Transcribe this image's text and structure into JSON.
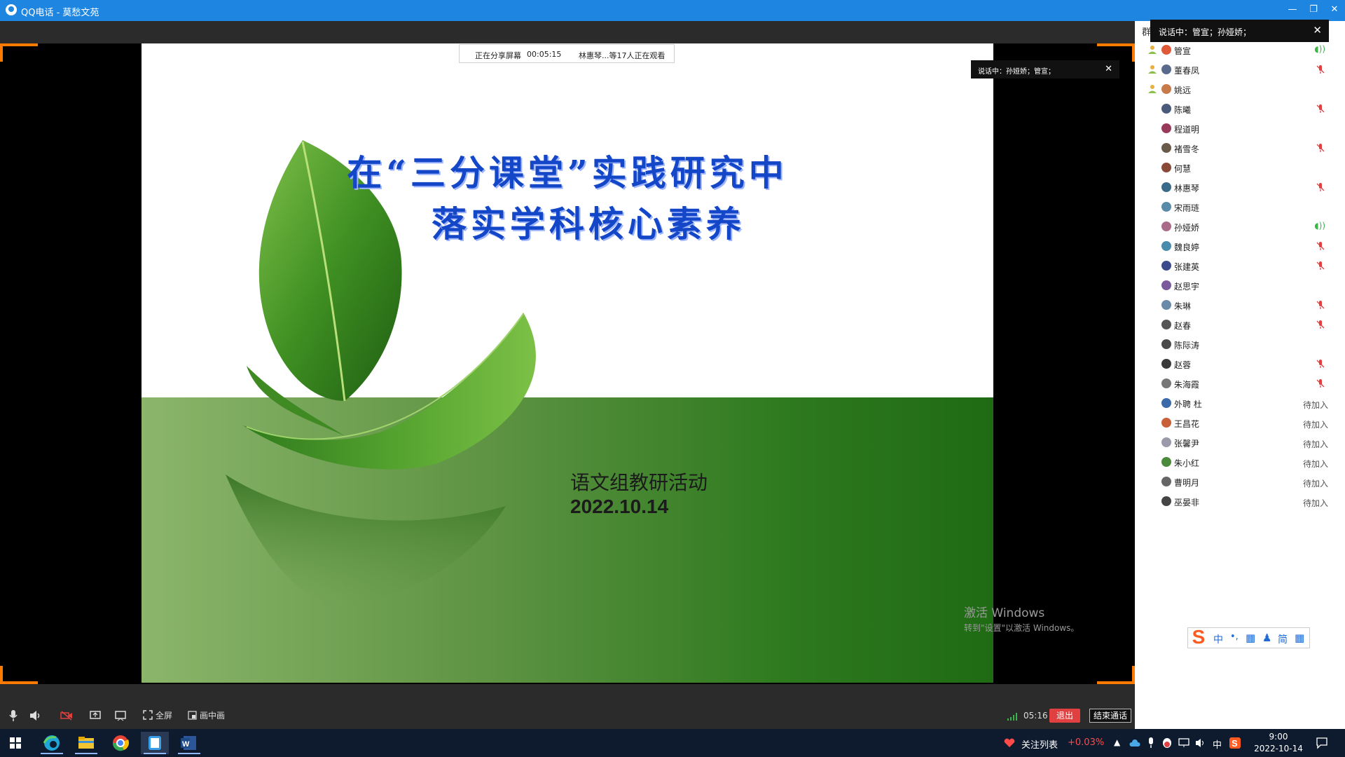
{
  "window": {
    "title": "QQ电话 - 莫愁文苑",
    "minimize": "—",
    "restore": "❐",
    "close": "✕"
  },
  "share_bar": {
    "sharing": "正在分享屏幕",
    "time": "00:05:15",
    "viewers": "林惠琴...等17人正在观看"
  },
  "speaking_popup": {
    "text": "说话中：孙娅娇；管宣；",
    "close": "✕"
  },
  "slide": {
    "title_line1": "在“三分课堂”实践研究中",
    "title_line2": "落实学科核心素养",
    "subtitle": "语文组教研活动",
    "date": "2022.10.14"
  },
  "watermark": {
    "line1": "激活 Windows",
    "line2": "转到\"设置\"以激活 Windows。"
  },
  "sidebar": {
    "header_char": "群",
    "speaking_tip": "说话中：管宣；孙娅娇；",
    "speaking_close": "✕",
    "members": [
      {
        "name": "管宣",
        "crown": true,
        "state": "speaking",
        "color": "#e05a3a"
      },
      {
        "name": "董春凤",
        "crown": true,
        "state": "muted",
        "color": "#5a6a8a"
      },
      {
        "name": "姚远",
        "crown": true,
        "state": "none",
        "color": "#c87a4a"
      },
      {
        "name": "陈曦",
        "crown": false,
        "state": "muted",
        "color": "#4a5a7a"
      },
      {
        "name": "程道明",
        "crown": false,
        "state": "none",
        "color": "#9a3a5a"
      },
      {
        "name": "褚雪冬",
        "crown": false,
        "state": "muted",
        "color": "#6a5a4a"
      },
      {
        "name": "何慧",
        "crown": false,
        "state": "none",
        "color": "#8a4a3a"
      },
      {
        "name": "林惠琴",
        "crown": false,
        "state": "muted",
        "color": "#3a6a8a"
      },
      {
        "name": "宋雨琏",
        "crown": false,
        "state": "none",
        "color": "#5a8aaa"
      },
      {
        "name": "孙娅娇",
        "crown": false,
        "state": "speaking",
        "color": "#aa6a8a"
      },
      {
        "name": "魏良婷",
        "crown": false,
        "state": "muted",
        "color": "#4a8aaa"
      },
      {
        "name": "张建英",
        "crown": false,
        "state": "muted",
        "color": "#3a4a8a"
      },
      {
        "name": "赵思宇",
        "crown": false,
        "state": "none",
        "color": "#7a5a9a"
      },
      {
        "name": "朱琳",
        "crown": false,
        "state": "muted",
        "color": "#6a8aaa"
      },
      {
        "name": "赵春",
        "crown": false,
        "state": "muted",
        "color": "#555555"
      },
      {
        "name": "陈际涛",
        "crown": false,
        "state": "none",
        "color": "#4a4a4a"
      },
      {
        "name": "赵蓉",
        "crown": false,
        "state": "muted",
        "color": "#3a3a3a"
      },
      {
        "name": "朱海霞",
        "crown": false,
        "state": "muted",
        "color": "#777777"
      },
      {
        "name": "外聘 杜",
        "crown": false,
        "state": "pending",
        "color": "#3a6aaa"
      },
      {
        "name": "王昌花",
        "crown": false,
        "state": "pending",
        "color": "#c8603a"
      },
      {
        "name": "张馨尹",
        "crown": false,
        "state": "pending",
        "color": "#9a9aaa"
      },
      {
        "name": "朱小红",
        "crown": false,
        "state": "pending",
        "color": "#4a8a3a"
      },
      {
        "name": "曹明月",
        "crown": false,
        "state": "pending",
        "color": "#666666"
      },
      {
        "name": "巫晏非",
        "crown": false,
        "state": "pending",
        "color": "#444444"
      }
    ],
    "pending_label": "待加入"
  },
  "ime": {
    "logo": "S",
    "chars": [
      "中",
      "•,",
      "▦",
      "♟",
      "简",
      "▦"
    ]
  },
  "controls": {
    "fullscreen": "全屏",
    "pip": "画中画",
    "duration": "05:16",
    "exit": "退出",
    "end_call": "结束通话"
  },
  "taskbar": {
    "stock_label": "关注列表",
    "stock_change": "+0.03%",
    "ime_char": "中",
    "time": "9:00",
    "date": "2022-10-14"
  },
  "colors": {
    "titlebar": "#1e86e1",
    "accent_orange": "#ff7a00",
    "exit_red": "#e04040",
    "slide_title_blue": "#1446c8",
    "stock_red": "#ff4a4a"
  }
}
